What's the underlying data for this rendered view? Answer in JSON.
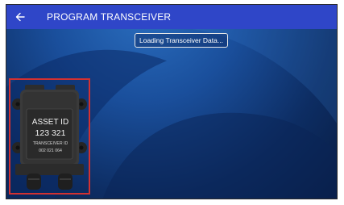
{
  "header": {
    "title": "PROGRAM TRANSCEIVER",
    "back_icon": "arrow-left-icon"
  },
  "status": {
    "message": "Loading Transceiver Data..."
  },
  "device": {
    "asset_id_label": "ASSET ID",
    "asset_id_value": "123 321",
    "transceiver_id_label": "TRANSCEIVER ID",
    "transceiver_id_value": "002 021 064",
    "highlight_color": "#d23131"
  },
  "colors": {
    "header": "#2f46c8",
    "background": "#1a4f9c"
  }
}
